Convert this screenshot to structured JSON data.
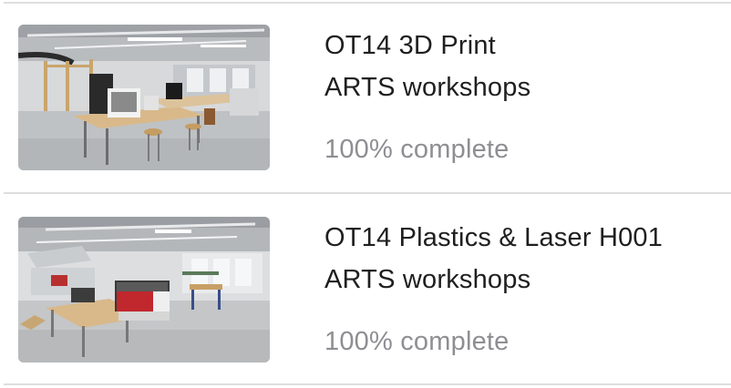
{
  "workshops": [
    {
      "title": "OT14 3D Print",
      "subtitle": "ARTS workshops",
      "progress_label": "100% complete",
      "progress": 1.0
    },
    {
      "title": "OT14 Plastics & Laser H001",
      "subtitle": "ARTS workshops",
      "progress_label": "100% complete",
      "progress": 1.0
    }
  ]
}
